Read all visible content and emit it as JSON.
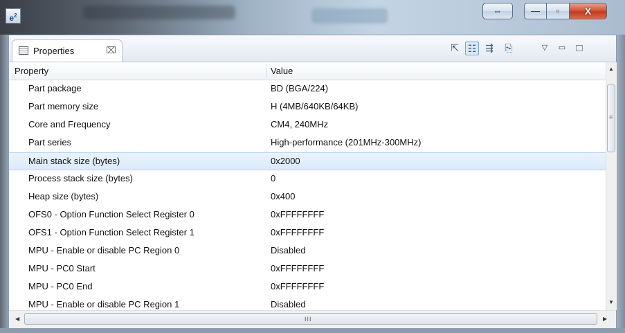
{
  "window": {
    "app_logo_text": "e",
    "app_logo_sup": "2",
    "resize_icon": "⇔",
    "minimize_icon": "—",
    "maximize_icon": "▫",
    "close_icon": "X"
  },
  "view": {
    "tab_label": "Properties",
    "tab_close_icon": "⌧",
    "toolbar": [
      {
        "name": "pin-to-selection-icon",
        "glyph": "⇱"
      },
      {
        "name": "show-categories-icon",
        "glyph": "☷"
      },
      {
        "name": "show-advanced-icon",
        "glyph": "⇶"
      },
      {
        "name": "restore-defaults-icon",
        "glyph": "⎘"
      },
      {
        "name": "view-menu-icon",
        "glyph": "▽"
      },
      {
        "name": "minimize-view-icon",
        "glyph": "▭"
      },
      {
        "name": "maximize-view-icon",
        "glyph": "□"
      }
    ]
  },
  "grid": {
    "col_property": "Property",
    "col_value": "Value",
    "selected_index": 4,
    "rows": [
      {
        "property": "Part package",
        "value": "BD (BGA/224)"
      },
      {
        "property": "Part memory size",
        "value": "H (4MB/640KB/64KB)"
      },
      {
        "property": "Core and Frequency",
        "value": "CM4, 240MHz"
      },
      {
        "property": "Part series",
        "value": "High-performance (201MHz-300MHz)"
      },
      {
        "property": "Main stack size (bytes)",
        "value": "0x2000"
      },
      {
        "property": "Process stack size (bytes)",
        "value": "0"
      },
      {
        "property": "Heap size (bytes)",
        "value": "0x400"
      },
      {
        "property": "OFS0 - Option Function Select Register 0",
        "value": "0xFFFFFFFF"
      },
      {
        "property": "OFS1 - Option Function Select Register 1",
        "value": "0xFFFFFFFF"
      },
      {
        "property": "MPU - Enable or disable PC Region 0",
        "value": "Disabled"
      },
      {
        "property": "MPU - PC0 Start",
        "value": "0xFFFFFFFF"
      },
      {
        "property": "MPU - PC0 End",
        "value": "0xFFFFFFFF"
      },
      {
        "property": "MPU - Enable or disable PC Region 1",
        "value": "Disabled"
      }
    ]
  },
  "scroll": {
    "up": "▲",
    "down": "▼",
    "left": "◀",
    "right": "▶",
    "vgrip": "≡",
    "hgrip": "III"
  }
}
